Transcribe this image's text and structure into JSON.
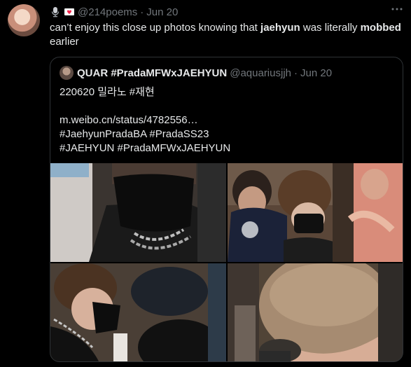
{
  "tweet": {
    "handle": "@214poems",
    "separator": "·",
    "time": "Jun 20",
    "more_icon": "more-dots-icon",
    "header_icons": [
      "microphone-emoji",
      "heart-letter-emoji"
    ],
    "text_part1": "can’t enjoy this close up photos knowing that ",
    "text_bold1": "jaehyun",
    "text_part2": " was literally ",
    "text_bold2": "mobbed",
    "text_part3": " earlier"
  },
  "quote": {
    "name": "QUAR #PradaMFWxJAEHYUN",
    "handle": "@aquariusjjh",
    "separator": "·",
    "time": "Jun 20",
    "line1": "220620 밀라노 #재현",
    "line2": "m.weibo.cn/status/4782556…",
    "line3": "#JaehyunPradaBA #PradaSS23",
    "line4": "#JAEHYUN #PradaMFWxJAEHYUN"
  },
  "colors": {
    "background": "#000000",
    "text": "#e7e9ea",
    "muted": "#71767b",
    "border": "#2f3336"
  }
}
